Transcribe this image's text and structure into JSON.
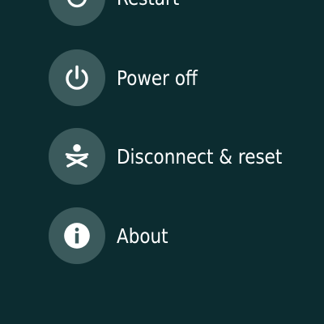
{
  "menu": {
    "items": [
      {
        "label": "Restart",
        "icon": "restart-icon"
      },
      {
        "label": "Power off",
        "icon": "power-icon"
      },
      {
        "label": "Disconnect & reset",
        "icon": "disconnect-reset-icon"
      },
      {
        "label": "About",
        "icon": "info-icon"
      }
    ]
  },
  "colors": {
    "background": "#0c2c30",
    "icon_circle": "#3b5a5c",
    "text": "#ffffff"
  }
}
